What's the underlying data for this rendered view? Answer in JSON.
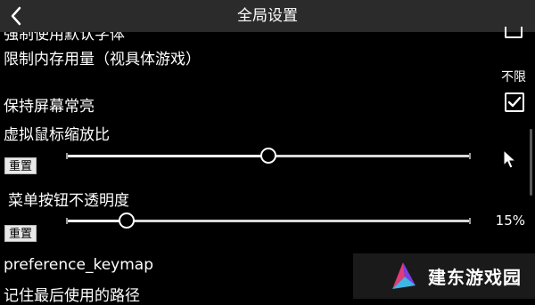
{
  "header": {
    "title": "全局设置"
  },
  "settings": {
    "clipped_label": "强制使用默认字体",
    "memory_limit": {
      "label": "限制内存用量（视具体游戏）",
      "value": "不限"
    },
    "keep_screen_on": {
      "label": "保持屏幕常亮",
      "checked": true
    },
    "cursor_scale": {
      "label": "虚拟鼠标缩放比",
      "reset_label": "重置",
      "level": 0.5
    },
    "menu_opacity": {
      "label": "菜单按钮不透明度",
      "reset_label": "重置",
      "value": "15%",
      "level": 0.15
    },
    "keymap": {
      "label": "preference_keymap"
    },
    "remember_path": {
      "label": "记住最后使用的路径"
    }
  },
  "watermark": {
    "text": "建东游戏园"
  }
}
